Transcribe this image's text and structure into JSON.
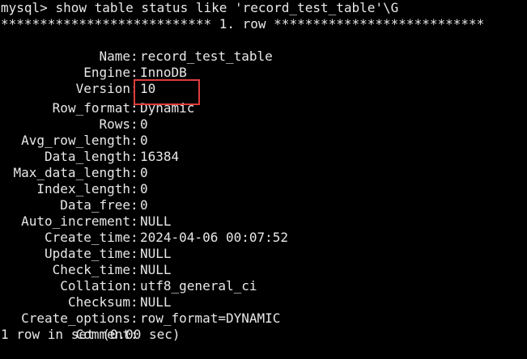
{
  "terminal": {
    "prompt": "mysql>",
    "command": "show table status like 'record_test_table'\\G",
    "row_separator_left": "***************************",
    "row_separator_label": "1. row",
    "row_separator_right": "***************************",
    "fields": [
      {
        "label": "Name",
        "value": "record_test_table"
      },
      {
        "label": "Engine",
        "value": "InnoDB"
      },
      {
        "label": "Version",
        "value": "10"
      },
      {
        "label": "Row_format",
        "value": "Dynamic"
      },
      {
        "label": "Rows",
        "value": "0"
      },
      {
        "label": "Avg_row_length",
        "value": "0"
      },
      {
        "label": "Data_length",
        "value": "16384"
      },
      {
        "label": "Max_data_length",
        "value": "0"
      },
      {
        "label": "Index_length",
        "value": "0"
      },
      {
        "label": "Data_free",
        "value": "0"
      },
      {
        "label": "Auto_increment",
        "value": "NULL"
      },
      {
        "label": "Create_time",
        "value": "2024-04-06 00:07:52"
      },
      {
        "label": "Update_time",
        "value": "NULL"
      },
      {
        "label": "Check_time",
        "value": "NULL"
      },
      {
        "label": "Collation",
        "value": "utf8_general_ci"
      },
      {
        "label": "Checksum",
        "value": "NULL"
      },
      {
        "label": "Create_options",
        "value": "row_format=DYNAMIC"
      },
      {
        "label": "Comment",
        "value": ""
      }
    ],
    "result_summary": "1 row in set (0.00 sec)"
  },
  "colors": {
    "background": "#000000",
    "text": "#e8e8e8",
    "highlight_border": "#e03c3c"
  }
}
